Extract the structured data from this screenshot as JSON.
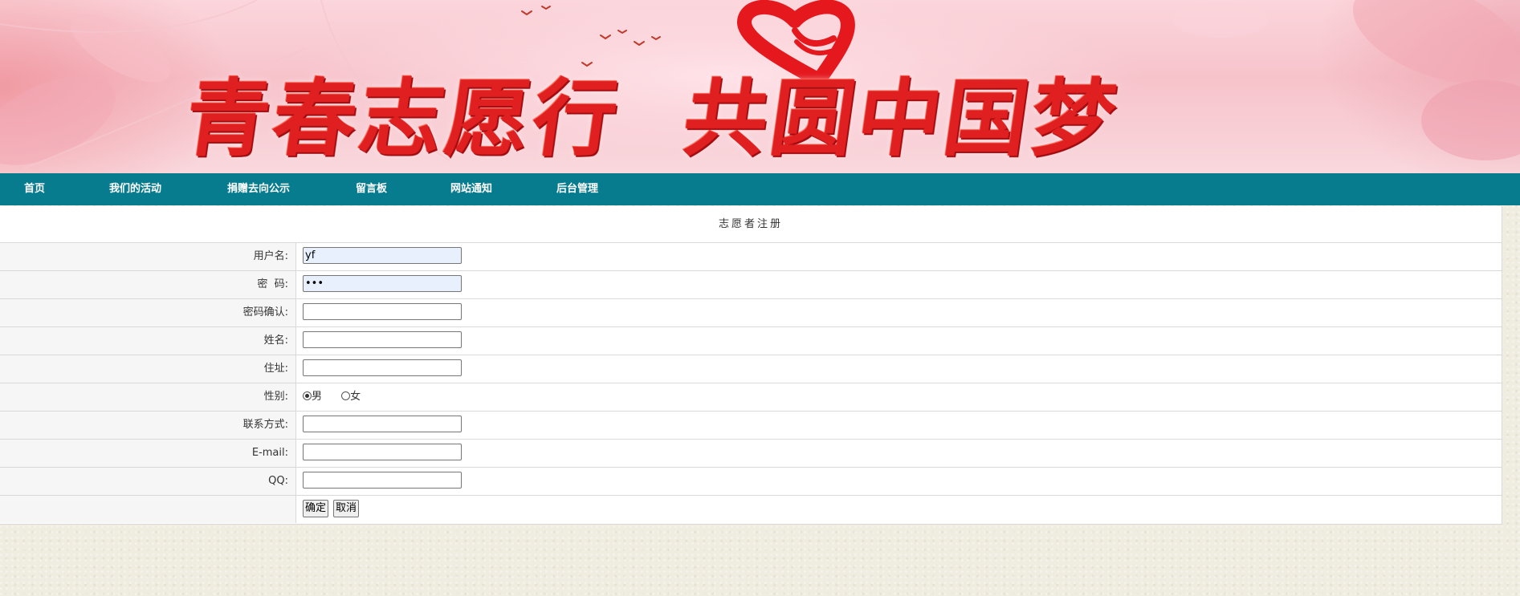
{
  "banner": {
    "title": "青春志愿行  共圆中国梦"
  },
  "nav": {
    "items": [
      {
        "label": "首页"
      },
      {
        "label": "我们的活动"
      },
      {
        "label": "捐赠去向公示"
      },
      {
        "label": "留言板"
      },
      {
        "label": "网站通知"
      },
      {
        "label": "后台管理"
      }
    ],
    "background_color": "#077c8e"
  },
  "form": {
    "title": "志愿者注册",
    "fields": {
      "username": {
        "label": "用户名:",
        "value": "yf"
      },
      "password": {
        "label": "密  码:",
        "value": "•••"
      },
      "password_confirm": {
        "label": "密码确认:",
        "value": ""
      },
      "name": {
        "label": "姓名:",
        "value": ""
      },
      "address": {
        "label": "住址:",
        "value": ""
      },
      "gender": {
        "label": "性别:",
        "options": [
          "男",
          "女"
        ],
        "selected": "男"
      },
      "contact": {
        "label": "联系方式:",
        "value": ""
      },
      "email": {
        "label": "E-mail:",
        "value": ""
      },
      "qq": {
        "label": "QQ:",
        "value": ""
      }
    },
    "buttons": {
      "confirm": "确定",
      "cancel": "取消"
    }
  },
  "colors": {
    "nav_bar": "#077c8e",
    "page_background": "#efece0",
    "banner_title": "#e02020",
    "autofill_field": "#e8f0fe"
  },
  "icons": {
    "banner_logo": "heart-hand-icon",
    "banner_decor": "flying-birds-icon"
  }
}
